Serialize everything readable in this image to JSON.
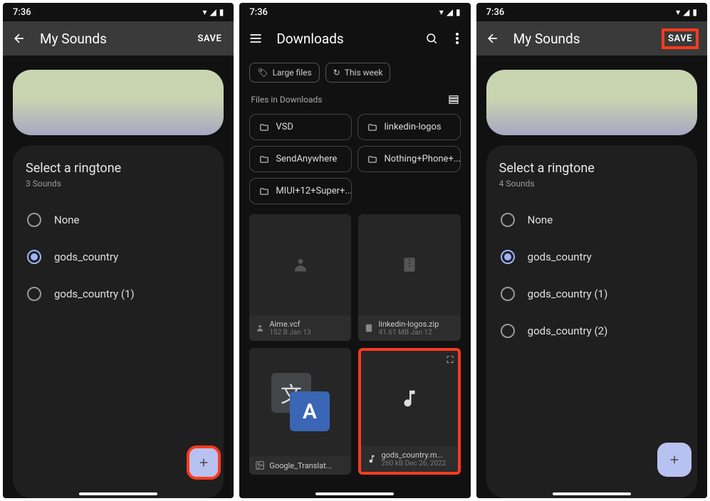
{
  "screens": [
    {
      "time": "7:36",
      "title": "My Sounds",
      "save_label": "SAVE",
      "card_title": "Select a ringtone",
      "card_sub": "3 Sounds",
      "items": [
        {
          "label": "None",
          "checked": false
        },
        {
          "label": "gods_country",
          "checked": true
        },
        {
          "label": "gods_country (1)",
          "checked": false
        }
      ]
    },
    {
      "time": "7:36",
      "title": "Downloads",
      "chips": [
        "Large files",
        "This week"
      ],
      "section": "Files in Downloads",
      "folders": [
        "VSD",
        "linkedin-logos",
        "SendAnywhere",
        "Nothing+Phone+...",
        "MIUI+12+Super+..."
      ],
      "files": [
        {
          "name": "Aime.vcf",
          "sub": "152 B Jan 13",
          "type": "contact"
        },
        {
          "name": "linkedin-logos.zip",
          "sub": "41.61 MB Jan 12",
          "type": "zip"
        },
        {
          "name": "Google_Translat...",
          "sub": "",
          "type": "translate"
        },
        {
          "name": "gods_country.m...",
          "sub": "260 kB Dec 26, 2022",
          "type": "audio"
        }
      ]
    },
    {
      "time": "7:36",
      "title": "My Sounds",
      "save_label": "SAVE",
      "card_title": "Select a ringtone",
      "card_sub": "4 Sounds",
      "items": [
        {
          "label": "None",
          "checked": false
        },
        {
          "label": "gods_country",
          "checked": true
        },
        {
          "label": "gods_country (1)",
          "checked": false
        },
        {
          "label": "gods_country (2)",
          "checked": false
        }
      ]
    }
  ]
}
